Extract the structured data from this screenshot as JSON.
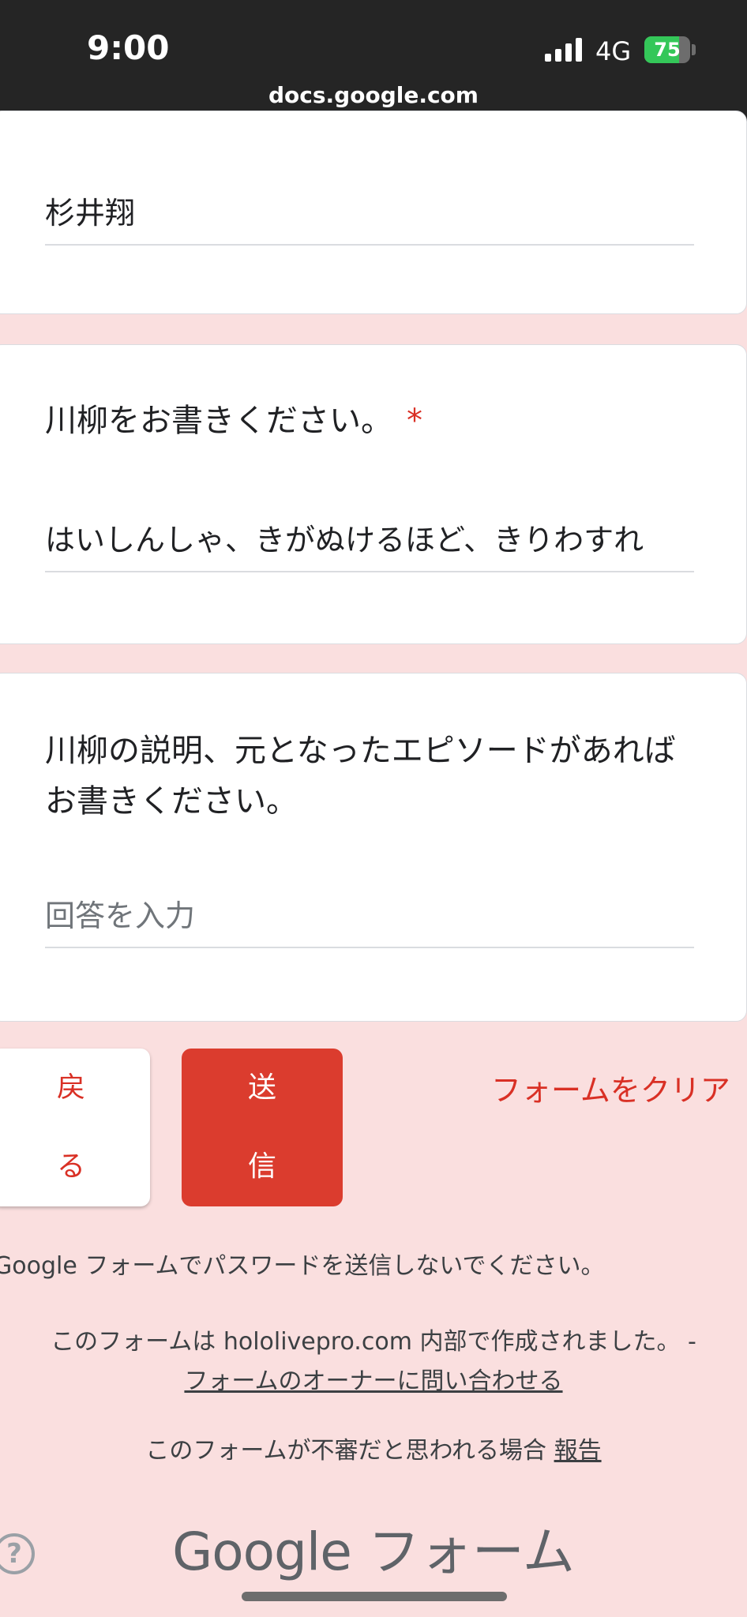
{
  "status_bar": {
    "time": "9:00",
    "network": "4G",
    "battery": "75",
    "battery_level": 0.75,
    "url": "docs.google.com"
  },
  "name_card": {
    "value": "杉井翔"
  },
  "senryu_card": {
    "question": "川柳をお書きください。",
    "required_mark": "*",
    "value": "はいしんしゃ、きがぬけるほど、きりわすれ"
  },
  "explain_card": {
    "question": "川柳の説明、元となったエピソードがあればお書きください。",
    "placeholder": "回答を入力"
  },
  "buttons": {
    "back": "戻る",
    "send": "送信",
    "clear": "フォームをクリア"
  },
  "footer": {
    "warning": "Google フォームでパスワードを送信しないでください。",
    "made_in": "このフォームは hololivepro.com 内部で作成されました。 -",
    "contact_owner": "フォームのオーナーに問い合わせる",
    "suspicious": "このフォームが不審だと思われる場合",
    "report": "報告",
    "logo_google": "Google",
    "logo_forms": "フォーム",
    "help": "?"
  },
  "colors": {
    "accent": "#d93025",
    "background": "#fadfdf",
    "send_button": "#db3c2e"
  }
}
